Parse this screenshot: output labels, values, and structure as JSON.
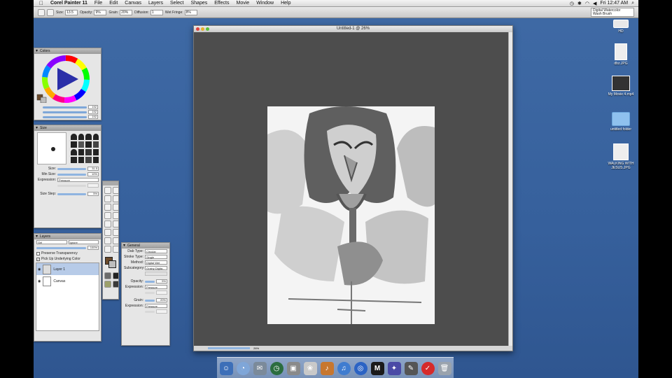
{
  "menubar": {
    "apple": "",
    "app": "Corel Painter 11",
    "items": [
      "File",
      "Edit",
      "Canvas",
      "Layers",
      "Select",
      "Shapes",
      "Effects",
      "Movie",
      "Window",
      "Help"
    ],
    "clock": "Fri 12:47 AM"
  },
  "propbar": {
    "fields": [
      {
        "label": "Size:",
        "value": "13.5"
      },
      {
        "label": "Opacity:",
        "value": "9%"
      },
      {
        "label": "Grain:",
        "value": "20%"
      },
      {
        "label": "Diffusion:",
        "value": "1"
      },
      {
        "label": "Wet Fringe:",
        "value": "8%"
      }
    ],
    "brush_category": "Digital Watercolor",
    "brush_variant": "Wash Brush"
  },
  "colors_panel": {
    "title": "Colors",
    "values": [
      "192",
      "192",
      "192"
    ]
  },
  "size_panel": {
    "title": "Size",
    "rows": [
      {
        "label": "Size:",
        "value": "31.5"
      },
      {
        "label": "Min Size:",
        "value": "10%"
      }
    ],
    "expression_label": "Expression:",
    "expression": "Pressure",
    "size_step_label": "Size Step:",
    "size_step": "5%"
  },
  "layers_panel": {
    "title": "Layers",
    "composite": "Gel",
    "method": "Ignore",
    "opacity": "100%",
    "preserve": "Preserve Transparency",
    "pick": "Pick Up Underlying Color",
    "layers": [
      "Layer 1",
      "Canvas"
    ]
  },
  "general_panel": {
    "title": "General",
    "rows": [
      {
        "label": "Dab Type:",
        "value": "Circular"
      },
      {
        "label": "Stroke Type:",
        "value": "Single"
      },
      {
        "label": "Method:",
        "value": "Digital Wet"
      },
      {
        "label": "Subcategory:",
        "value": "Grainy Digita..."
      }
    ],
    "opacity_label": "Opacity:",
    "opacity": "5%",
    "expression_label": "Expression:",
    "expression": "Pressure",
    "grain_label": "Grain:",
    "grain": "20%",
    "expression2": "Pressure"
  },
  "canvas_window": {
    "title": "Untitled-1 @ 26%",
    "zoom": "26%"
  },
  "desktop": [
    {
      "label": "HD"
    },
    {
      "label": "dbz.JPG"
    },
    {
      "label": "My Movie 4.mp4"
    },
    {
      "label": "untitled folder"
    },
    {
      "label": "WALKING WITH JESUS.JPG"
    }
  ]
}
